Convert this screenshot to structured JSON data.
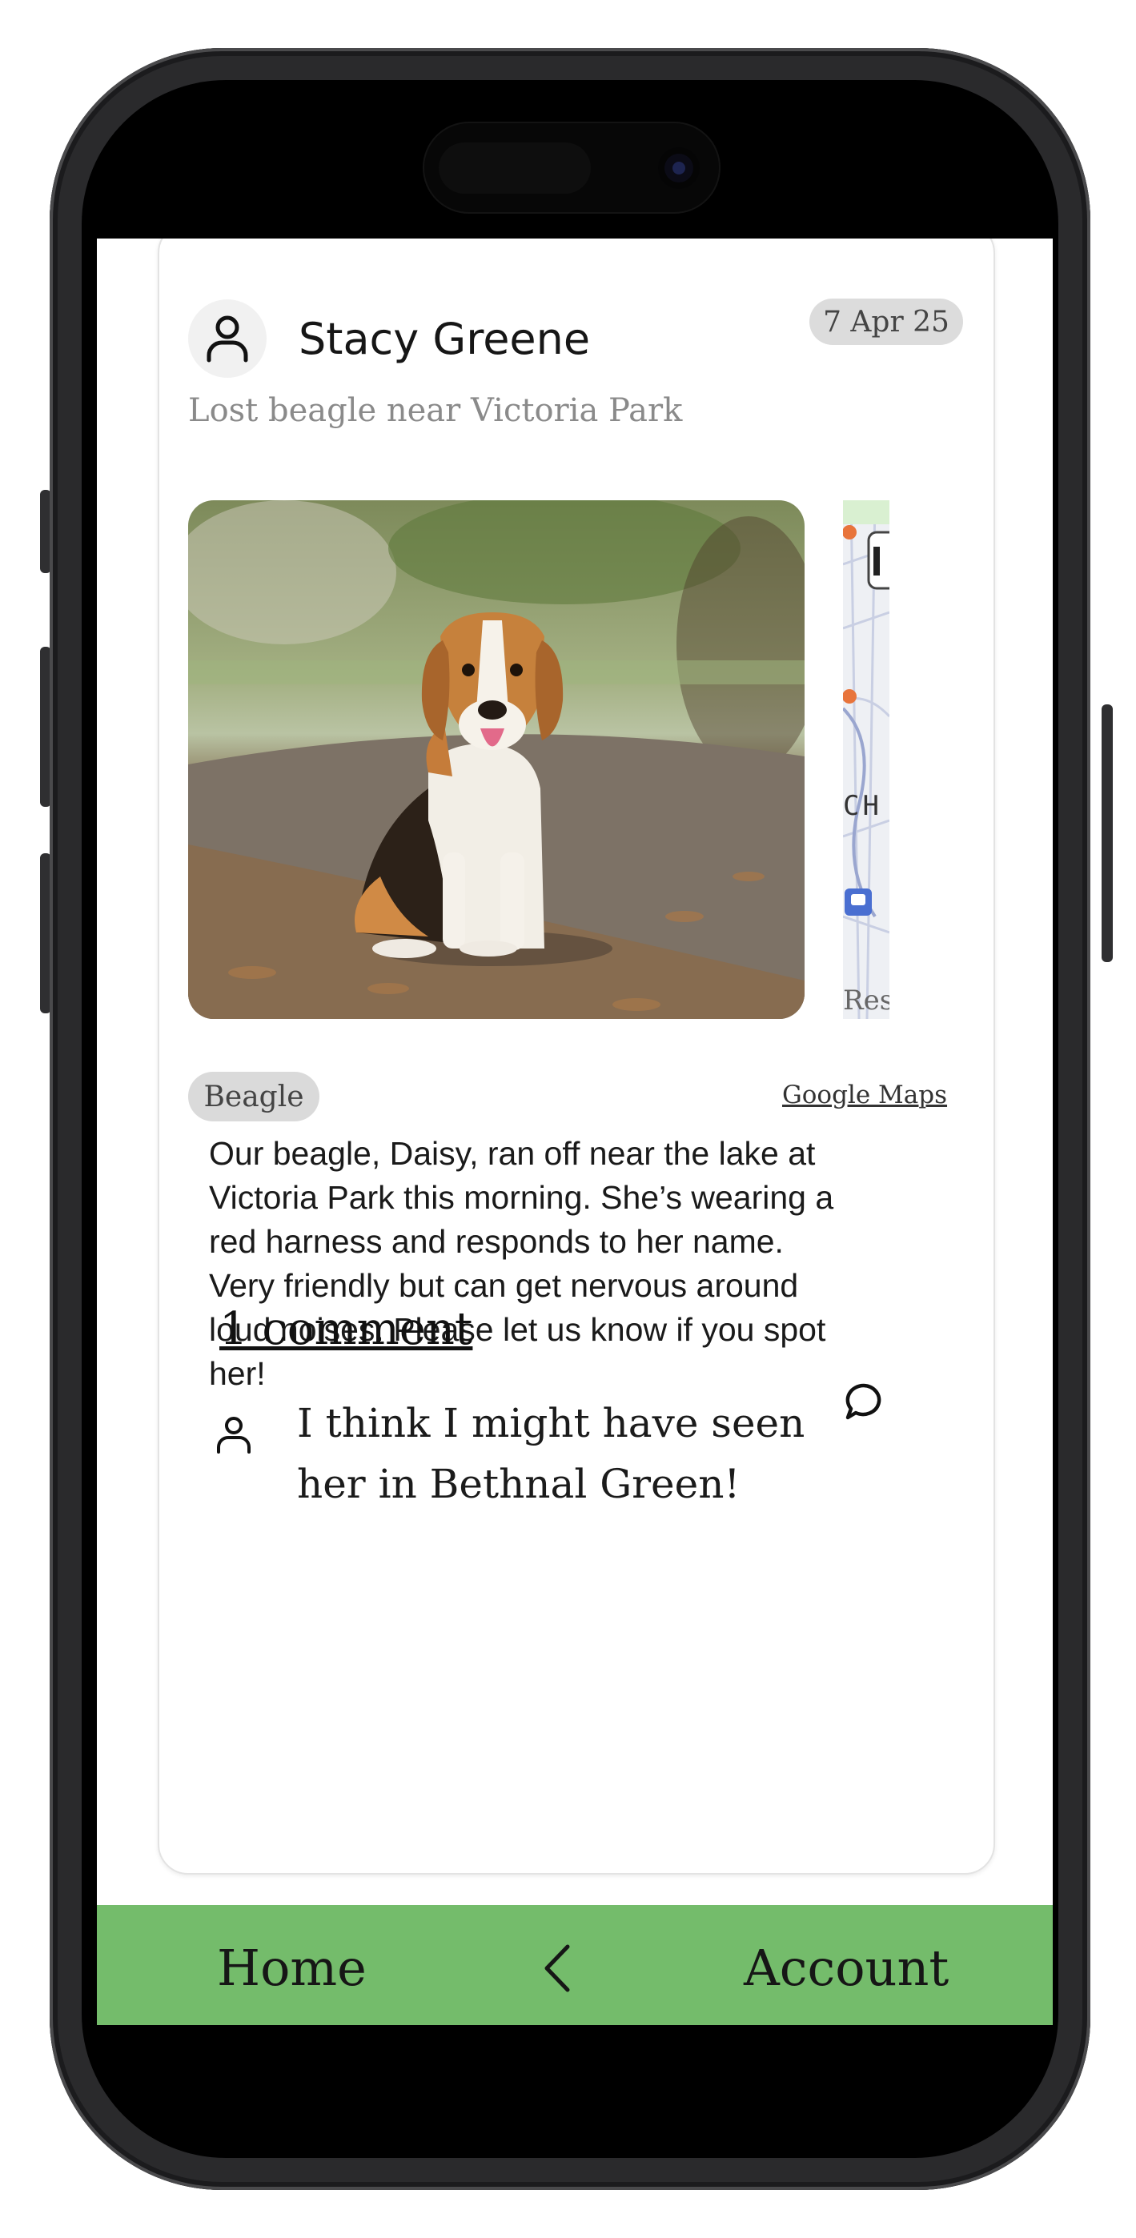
{
  "post": {
    "author": "Stacy Greene",
    "date": "7 Apr 25",
    "title": "Lost beagle near Victoria Park",
    "breed_tag": "Beagle",
    "maps_link": "Google Maps",
    "map_label_1": "CH",
    "map_label_2": "Res",
    "description": "Our beagle, Daisy, ran off near the lake at Victoria Park this morning. She’s wearing a red harness and responds to her name. Very friendly but can get nervous around loud noises. Please let us know if you spot her!"
  },
  "comments": {
    "count_label": "1 comment",
    "items": [
      {
        "text": "I think I might have seen her in Bethnal Green!"
      }
    ]
  },
  "nav": {
    "home": "Home",
    "account": "Account"
  },
  "colors": {
    "nav_background": "#74bc6b",
    "badge_background": "#dcdcdc"
  },
  "icons": {
    "author_avatar": "user-icon",
    "comment_action": "speech-bubble-icon",
    "commenter_avatar": "user-icon",
    "back": "chevron-left-icon"
  }
}
